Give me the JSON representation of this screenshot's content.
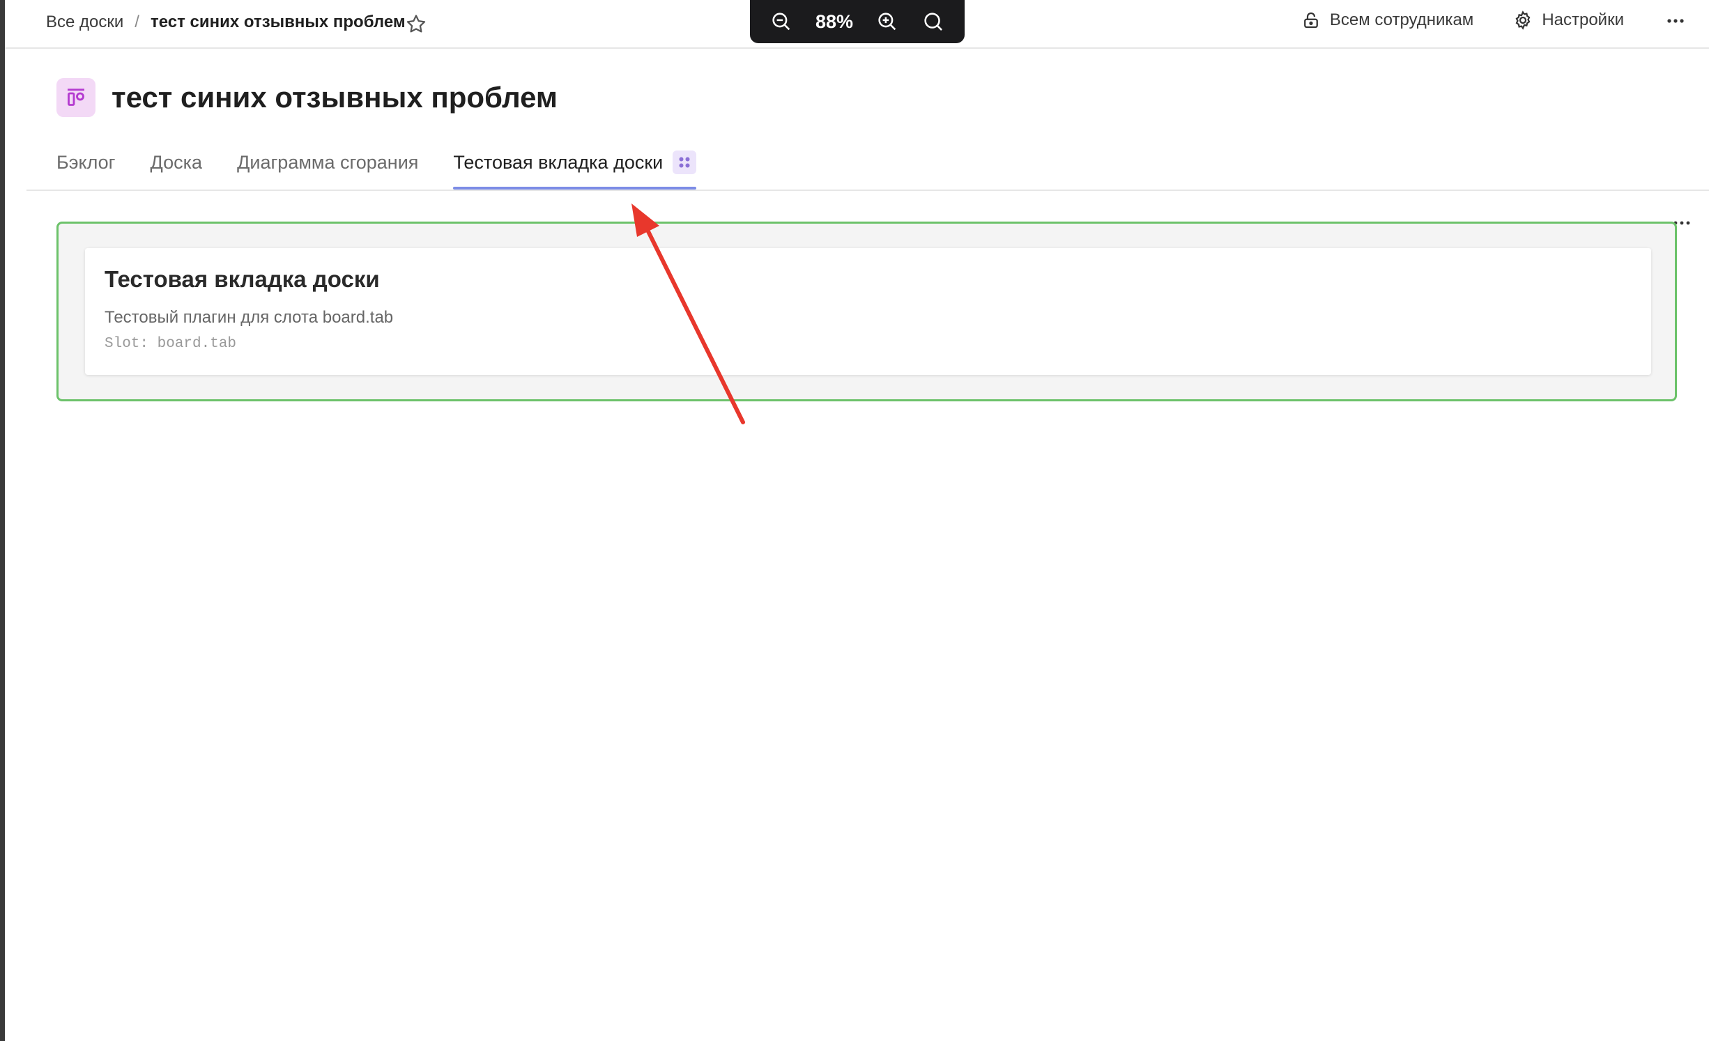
{
  "breadcrumb": {
    "root": "Все доски",
    "separator": "/",
    "current": "тест синих отзывных проблем"
  },
  "zoom": {
    "level": "88%"
  },
  "header_actions": {
    "access_label": "Всем сотрудникам",
    "settings_label": "Настройки"
  },
  "board": {
    "title": "тест синих отзывных проблем"
  },
  "tabs": [
    {
      "label": "Бэклог"
    },
    {
      "label": "Доска"
    },
    {
      "label": "Диаграмма сгорания"
    },
    {
      "label": "Тестовая вкладка доски",
      "active": true
    }
  ],
  "plugin": {
    "title": "Тестовая вкладка доски",
    "description": "Тестовый плагин для слота board.tab",
    "slot": "Slot: board.tab"
  },
  "colors": {
    "accent_tab_underline": "#7c8ce6",
    "plugin_border": "#6cc26a",
    "annotation_arrow": "#e8372c",
    "board_icon_bg": "#f3d9f6"
  }
}
